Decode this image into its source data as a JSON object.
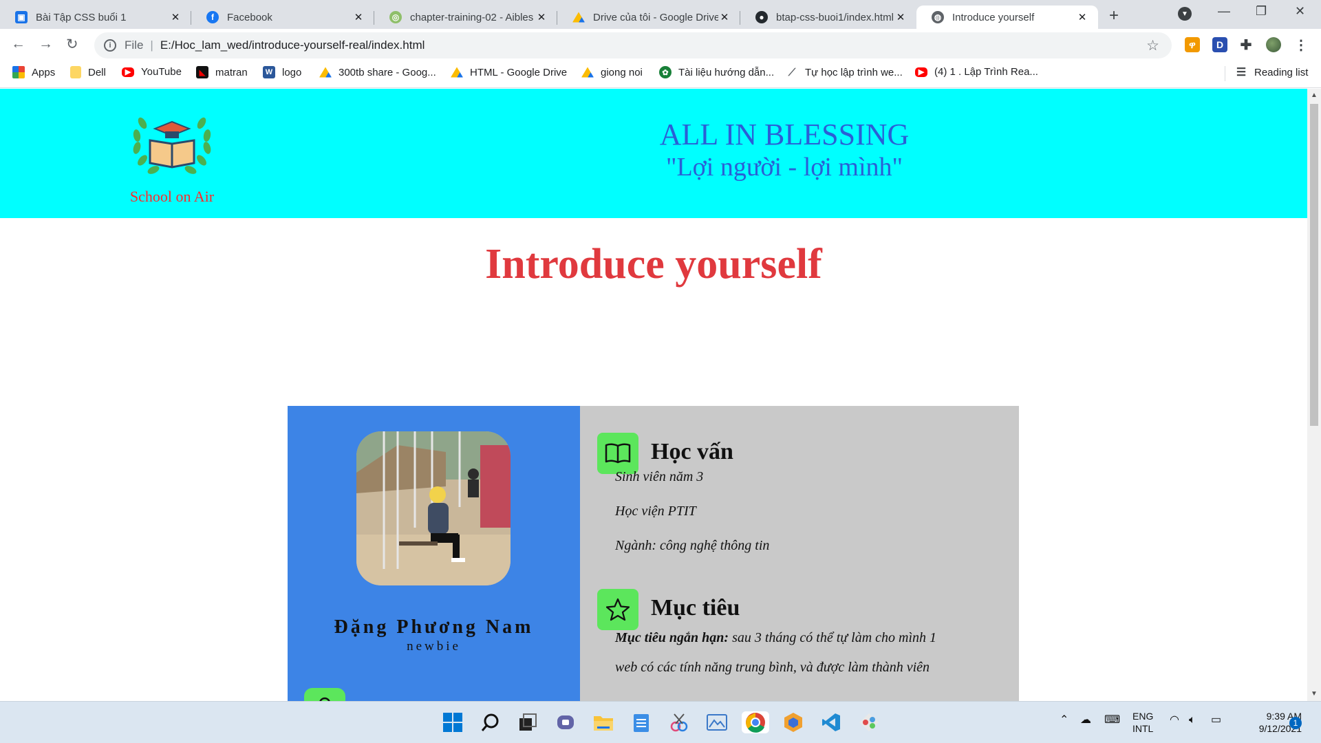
{
  "browser": {
    "tabs": [
      {
        "title": "Bài Tập CSS buổi 1",
        "icon": "classroom-icon",
        "color": "#1a73e8"
      },
      {
        "title": "Facebook",
        "icon": "facebook-icon",
        "color": "#1877f2"
      },
      {
        "title": "chapter-training-02 - Aibles",
        "icon": "aibles-icon",
        "color": "#34a853"
      },
      {
        "title": "Drive của tôi - Google Drive",
        "icon": "google-drive-icon",
        "color": "#fbbc04"
      },
      {
        "title": "btap-css-buoi1/index.html a",
        "icon": "github-icon",
        "color": "#24292e"
      },
      {
        "title": "Introduce yourself",
        "icon": "globe-icon",
        "color": "#5f6368"
      }
    ],
    "active_tab": 5,
    "address": {
      "scheme": "File",
      "url": "E:/Hoc_lam_wed/introduce-yourself-real/index.html"
    },
    "bookmarks": [
      {
        "label": "Apps",
        "icon": "apps-grid-icon",
        "color": "#ea4335"
      },
      {
        "label": "Dell",
        "icon": "folder-icon",
        "color": "#fdd663"
      },
      {
        "label": "YouTube",
        "icon": "youtube-icon",
        "color": "#ff0000"
      },
      {
        "label": "matran",
        "icon": "matran-icon",
        "color": "#111111"
      },
      {
        "label": "logo",
        "icon": "word-icon",
        "color": "#2b579a"
      },
      {
        "label": "300tb share - Goog...",
        "icon": "google-drive-icon",
        "color": "#fbbc04"
      },
      {
        "label": "HTML - Google Drive",
        "icon": "google-drive-icon",
        "color": "#34a853"
      },
      {
        "label": "giong noi",
        "icon": "google-drive-icon",
        "color": "#1a73e8"
      },
      {
        "label": "Tài liệu hướng dẫn...",
        "icon": "globe-green-icon",
        "color": "#188038"
      },
      {
        "label": "Tự học lập trình we...",
        "icon": "link-icon",
        "color": "#5f6368"
      },
      {
        "label": "(4) 1 . Lập Trình Rea...",
        "icon": "youtube-icon",
        "color": "#ff0000"
      }
    ],
    "reading_list": "Reading list"
  },
  "site": {
    "logo_text": "School on Air",
    "brand_line1": "ALL IN BLESSING",
    "brand_line2": "\"Lợi người - lợi mình\"",
    "page_title": "Introduce yourself",
    "profile": {
      "name": "Đặng Phương Nam",
      "role": "newbie"
    },
    "education": {
      "title": "Học vấn",
      "items": [
        "Sinh viên năm 3",
        "Học viện PTIT",
        "Ngành: công nghệ thông tin"
      ]
    },
    "goals": {
      "title": "Mục tiêu",
      "short_label": "Mục tiêu ngắn hạn:",
      "short_text": " sau 3 tháng có thể tự làm cho mình 1",
      "line2": "web có các tính năng trung bình, và được làm thành viên"
    }
  },
  "taskbar": {
    "lang_line1": "ENG",
    "lang_line2": "INTL",
    "time": "9:39 AM",
    "date": "9/12/2021",
    "notifications": "1"
  },
  "colors": {
    "header_bg": "#00ffff",
    "brand_text": "#2a5fd6",
    "title_red": "#e0393e",
    "left_panel": "#3d84e6",
    "right_panel": "#c9c9c9",
    "icon_green": "#5ce65c"
  }
}
